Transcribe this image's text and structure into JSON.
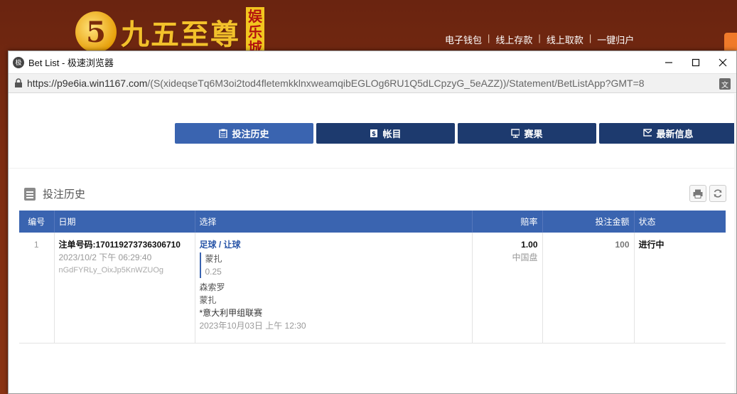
{
  "bg": {
    "logo_number": "5",
    "logo_text": "九五至尊",
    "logo_sub": "娱乐城",
    "nav": [
      "电子钱包",
      "线上存款",
      "线上取款",
      "一键归户"
    ]
  },
  "window": {
    "title": "Bet List - 极速浏览器",
    "app_icon_label": "极",
    "url_main": "https://p9e6ia.win1167.com",
    "url_rest": "/(S(xideqseTq6M3oi2tod4fletemkklnxweamqibEGLOg6RU1Q5dLCpzyG_5eAZZ))/Statement/BetListApp?GMT=8"
  },
  "tabs": [
    {
      "label": "投注历史",
      "icon": "clipboard-icon"
    },
    {
      "label": "帐目",
      "icon": "money-icon"
    },
    {
      "label": "赛果",
      "icon": "scoreboard-icon"
    },
    {
      "label": "最新信息",
      "icon": "envelope-icon"
    }
  ],
  "section_title": "投注历史",
  "table": {
    "headers": [
      "编号",
      "日期",
      "选择",
      "赔率",
      "投注金额",
      "状态"
    ],
    "row": {
      "num": "1",
      "ticket": "注单号码:170119273736306710",
      "datetime": "2023/10/2 下午 06:29:40",
      "code": "nGdFYRLy_OixJp5KnWZUOg",
      "sport": "足球 / 让球",
      "pick": "蒙扎",
      "handicap": "0.25",
      "team1": "森索罗",
      "team2": "蒙扎",
      "league": "*意大利甲组联赛",
      "match_time": "2023年10月03日 上午 12:30",
      "odds": "1.00",
      "odds_type": "中国盘",
      "stake": "100",
      "status": "进行中"
    }
  },
  "colors": {
    "tab_active": "#3a64b0",
    "tab": "#1d3a6e",
    "header": "#3a64b0"
  }
}
